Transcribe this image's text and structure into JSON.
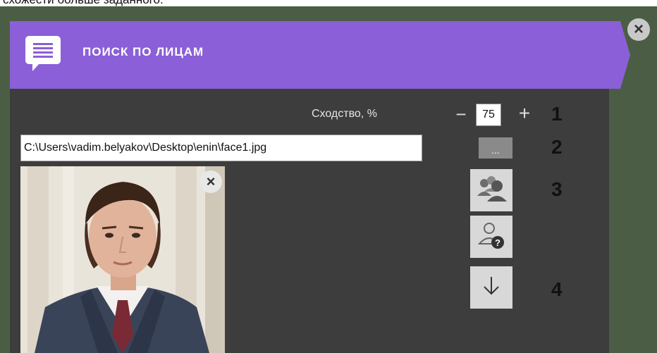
{
  "caption": "схожести больше заданного.",
  "header": {
    "title": "ПОИСК ПО ЛИЦАМ",
    "icon": "message-list-icon"
  },
  "close_icon": "×",
  "similarity": {
    "label": "Сходство, %",
    "value": "75",
    "minus": "−",
    "plus": "+"
  },
  "file": {
    "path": "C:\\Users\\vadim.belyakov\\Desktop\\enin\\face1.jpg",
    "browse_label": "..."
  },
  "photo": {
    "close": "×"
  },
  "buttons": {
    "search_persons_icon": "group-search-icon",
    "unknown_person_icon": "unknown-person-icon",
    "download_icon": "arrow-down-icon"
  },
  "markers": {
    "m1": "1",
    "m2": "2",
    "m3": "3",
    "m4": "4"
  },
  "colors": {
    "header": "#8b5fd8",
    "panel": "#3d3d3d",
    "outer": "#4b5e45"
  }
}
